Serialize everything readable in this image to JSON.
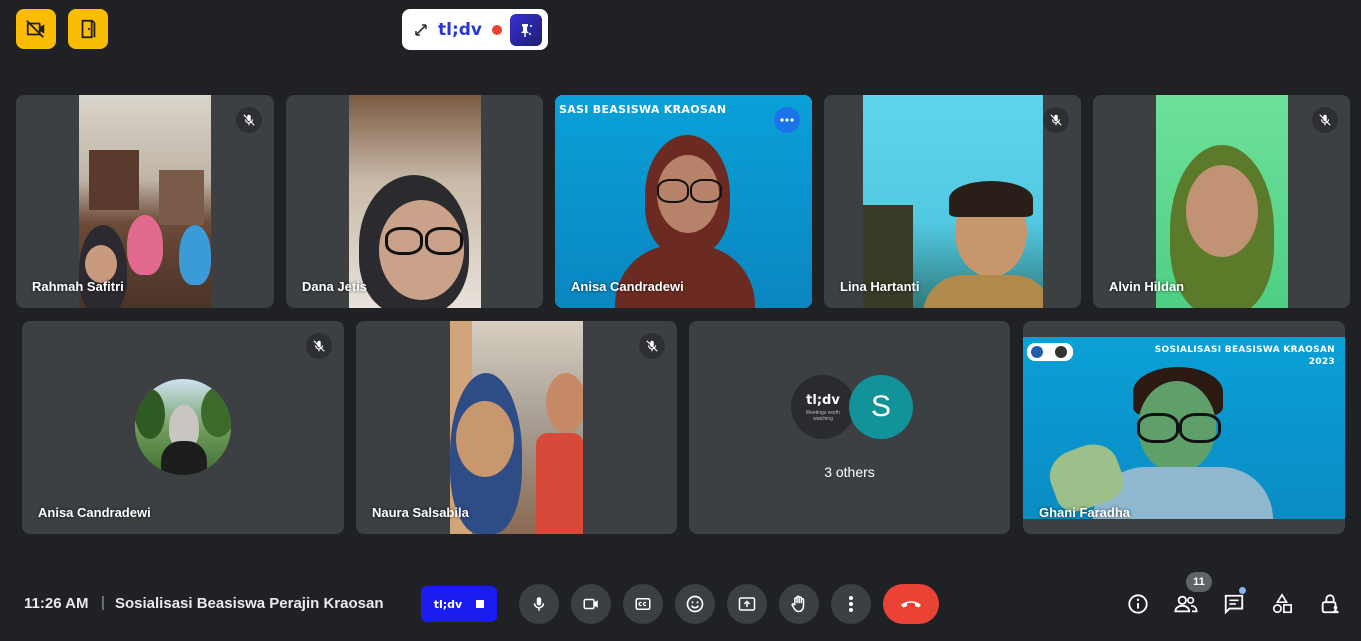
{
  "top": {
    "btn1_icon": "video-off-icon",
    "btn2_icon": "door-exit-icon",
    "tldv_brand": "tl;dv",
    "tldv_expand_icon": "expand-diagonal-icon",
    "tldv_wand_icon": "magic-pin-icon"
  },
  "tiles": [
    {
      "name": "Rahmah Safitri",
      "muted": true
    },
    {
      "name": "Dana Jetis",
      "muted": false
    },
    {
      "name": "Anisa Candradewi",
      "muted": false,
      "banner": "SASI BEASISWA KRAOSAN"
    },
    {
      "name": "Lina Hartanti",
      "muted": true
    },
    {
      "name": "Alvin Hildan",
      "muted": true
    },
    {
      "name": "Anisa Candradewi",
      "muted": true
    },
    {
      "name": "Naura Salsabila",
      "muted": true
    },
    {
      "name": "3 others",
      "avatar_left": "tl;dv",
      "avatar_left_sub": "Meetings worth watching",
      "avatar_right": "S"
    },
    {
      "name": "Ghani Faradha",
      "banner_line1": "SOSIALISASI BEASISWA KRAOSAN",
      "banner_line2": "2023"
    }
  ],
  "bottom": {
    "time": "11:26 AM",
    "separator": "|",
    "meeting_title": "Sosialisasi Beasiswa Perajin Kraosan",
    "tldv_button": "tl;dv",
    "people_count": "11",
    "colors": {
      "end_call": "#ea4335",
      "accent": "#8ab4f8",
      "tldv_blue": "#2b35d6"
    }
  }
}
